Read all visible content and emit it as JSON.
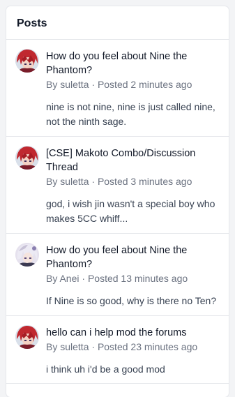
{
  "panel": {
    "title": "Posts"
  },
  "posts": [
    {
      "avatar_icon": "red-haired-character-avatar-icon",
      "title": "How do you feel about Nine the Phantom?",
      "by_label": "By",
      "author": "suletta",
      "separator": "·",
      "time": "Posted 2 minutes ago",
      "excerpt": "nine is not nine, nine is just called nine, not the ninth sage."
    },
    {
      "avatar_icon": "red-haired-character-avatar-icon",
      "title": "[CSE] Makoto Combo/Discussion Thread",
      "by_label": "By",
      "author": "suletta",
      "separator": "·",
      "time": "Posted 3 minutes ago",
      "excerpt": "god, i wish jin wasn't a special boy who makes 5CC whiff..."
    },
    {
      "avatar_icon": "white-haired-character-avatar-icon",
      "title": "How do you feel about Nine the Phantom?",
      "by_label": "By",
      "author": "Anei",
      "separator": "·",
      "time": "Posted 13 minutes ago",
      "excerpt": "If Nine is so good, why is there no Ten?"
    },
    {
      "avatar_icon": "red-haired-character-avatar-icon",
      "title": "hello can i help mod the forums",
      "by_label": "By",
      "author": "suletta",
      "separator": "·",
      "time": "Posted 23 minutes ago",
      "excerpt": "i think uh i'd be a good mod"
    }
  ]
}
